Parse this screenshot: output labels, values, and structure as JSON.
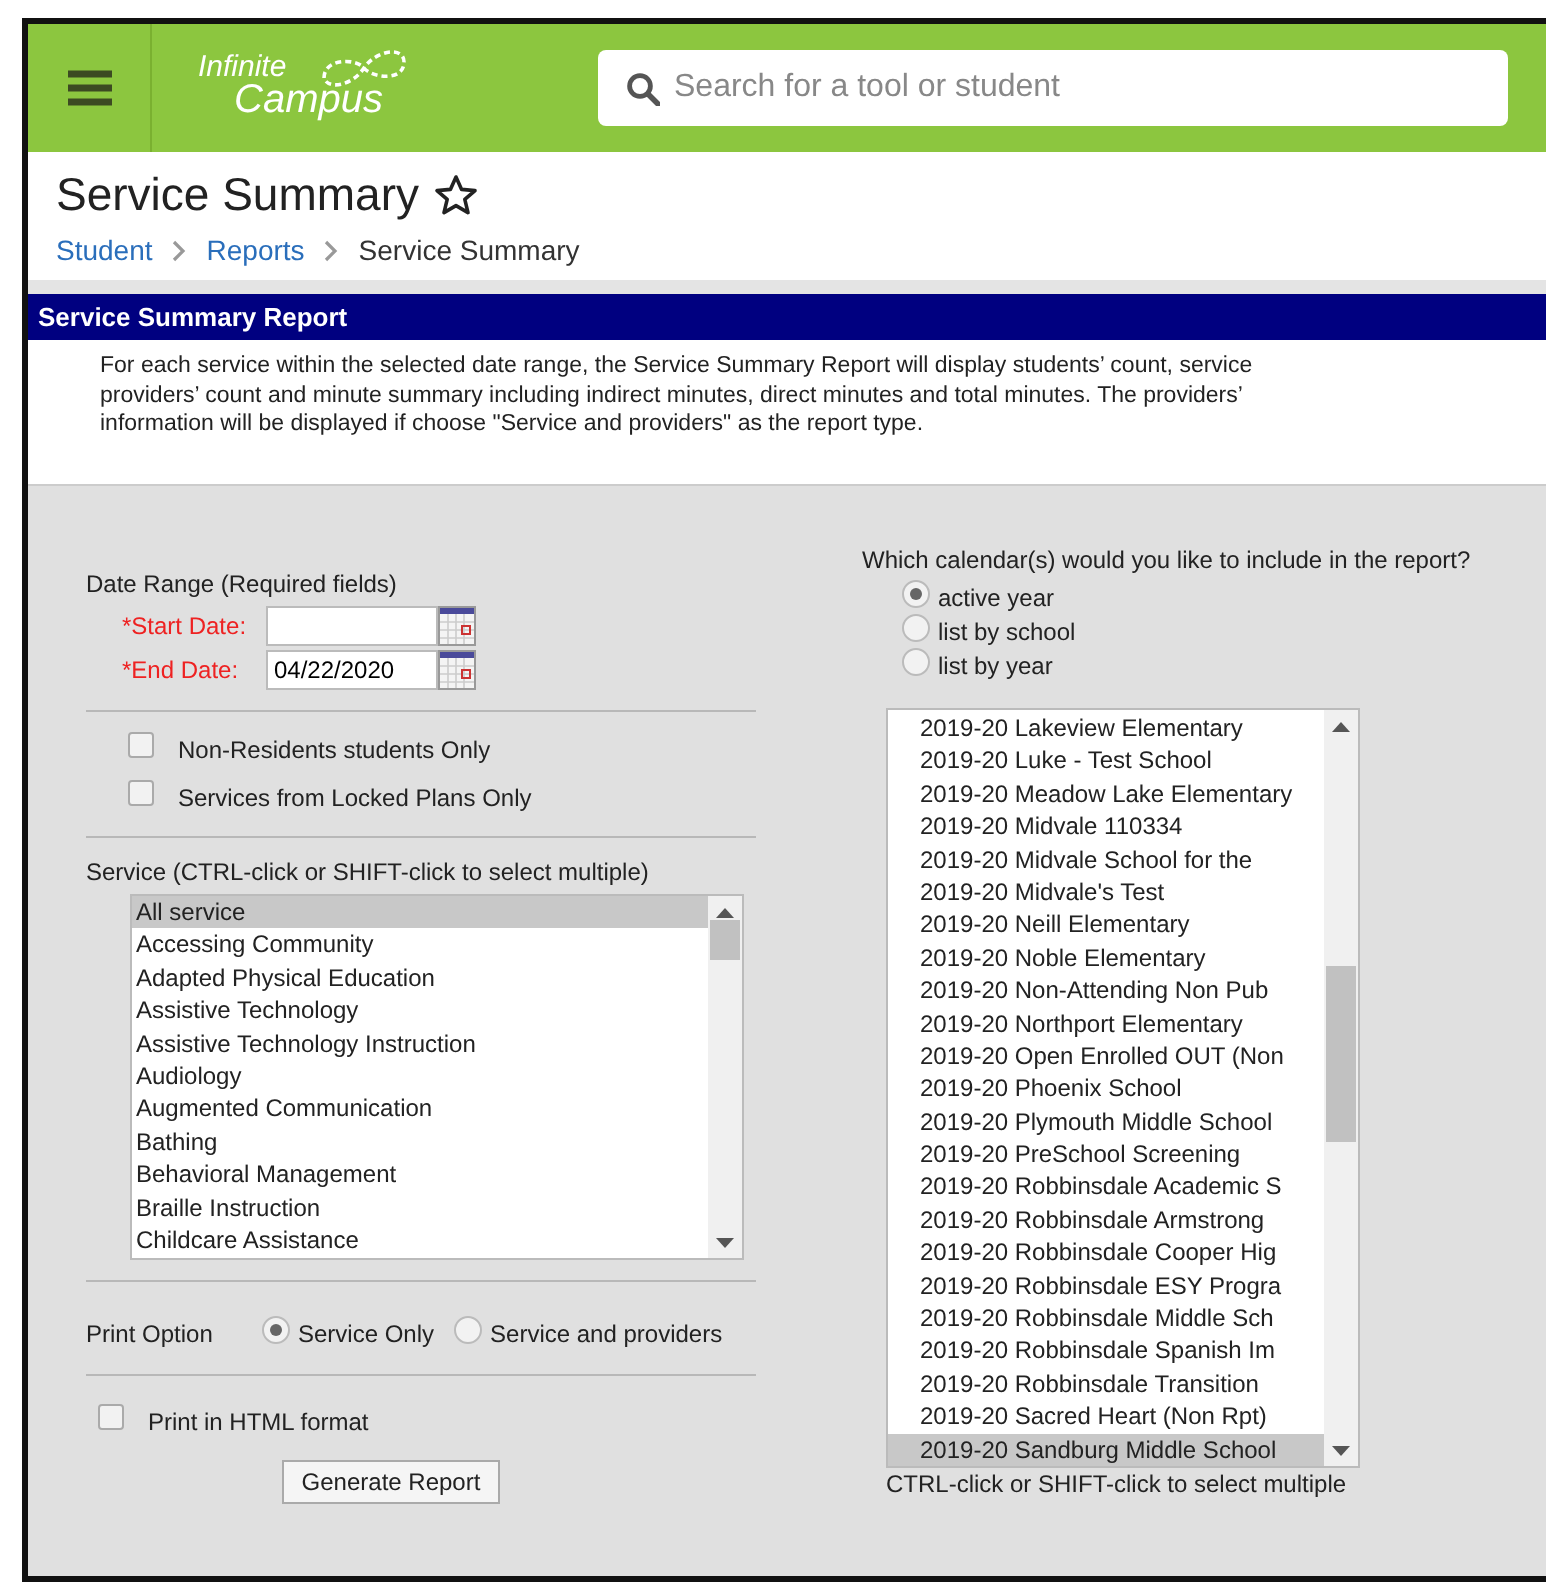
{
  "header": {
    "logo": {
      "line1": "Infinite",
      "line2": "Campus"
    },
    "search": {
      "placeholder": "Search for a tool or student"
    }
  },
  "page": {
    "title": "Service Summary",
    "breadcrumb": [
      {
        "label": "Student",
        "link": true
      },
      {
        "label": "Reports",
        "link": true
      },
      {
        "label": "Service Summary",
        "link": false
      }
    ]
  },
  "report": {
    "title": "Service Summary Report",
    "description": "For each service within the selected date range, the Service Summary Report will display students’ count, service providers’ count and minute summary including indirect minutes, direct minutes and total minutes. The providers’ information will be displayed if choose \"Service and providers\" as the report type."
  },
  "date_range": {
    "label": "Date Range (Required fields)",
    "fields": [
      {
        "label": "*Start Date:",
        "required": true
      },
      {
        "label": "*End Date:",
        "value": "04/22/2020",
        "required": true
      }
    ]
  },
  "filters": [
    {
      "label": "Non-Residents students Only",
      "checked": false
    },
    {
      "label": "Services from Locked Plans Only",
      "checked": false
    }
  ],
  "service": {
    "label": "Service (CTRL-click or SHIFT-click to select multiple)",
    "items": [
      {
        "label": "All service",
        "selected": true
      },
      {
        "label": "Accessing Community",
        "selected": false
      },
      {
        "label": "Adapted Physical Education",
        "selected": false
      },
      {
        "label": "Assistive Technology",
        "selected": false
      },
      {
        "label": "Assistive Technology Instruction",
        "selected": false
      },
      {
        "label": "Audiology",
        "selected": false
      },
      {
        "label": "Augmented Communication",
        "selected": false
      },
      {
        "label": "Bathing",
        "selected": false
      },
      {
        "label": "Behavioral Management",
        "selected": false
      },
      {
        "label": "Braille Instruction",
        "selected": false
      },
      {
        "label": "Childcare Assistance",
        "selected": false
      }
    ]
  },
  "print_option": {
    "label": "Print Option",
    "options": [
      {
        "label": "Service Only",
        "selected": true
      },
      {
        "label": "Service and providers",
        "selected": false
      }
    ]
  },
  "html_format": {
    "label": "Print in HTML format",
    "checked": false
  },
  "generate_button": "Generate Report",
  "calendars": {
    "question": "Which calendar(s) would you like to include in the report?",
    "options": [
      {
        "label": "active year",
        "selected": true
      },
      {
        "label": "list by school",
        "selected": false
      },
      {
        "label": "list by year",
        "selected": false
      }
    ],
    "items": [
      {
        "label": "2019-20 Lakeview Elementary",
        "selected": false
      },
      {
        "label": "2019-20 Luke - Test School",
        "selected": false
      },
      {
        "label": "2019-20 Meadow Lake Elementary",
        "selected": false
      },
      {
        "label": "2019-20 Midvale 110334",
        "selected": false
      },
      {
        "label": "2019-20 Midvale School for the",
        "selected": false
      },
      {
        "label": "2019-20 Midvale's Test",
        "selected": false
      },
      {
        "label": "2019-20 Neill Elementary",
        "selected": false
      },
      {
        "label": "2019-20 Noble Elementary",
        "selected": false
      },
      {
        "label": "2019-20 Non-Attending Non Pub",
        "selected": false
      },
      {
        "label": "2019-20 Northport Elementary",
        "selected": false
      },
      {
        "label": "2019-20 Open Enrolled OUT (Non",
        "selected": false
      },
      {
        "label": "2019-20 Phoenix School",
        "selected": false
      },
      {
        "label": "2019-20 Plymouth Middle School",
        "selected": false
      },
      {
        "label": "2019-20 PreSchool Screening",
        "selected": false
      },
      {
        "label": "2019-20 Robbinsdale Academic S",
        "selected": false
      },
      {
        "label": "2019-20 Robbinsdale Armstrong",
        "selected": false
      },
      {
        "label": "2019-20 Robbinsdale Cooper Hig",
        "selected": false
      },
      {
        "label": "2019-20 Robbinsdale ESY Progra",
        "selected": false
      },
      {
        "label": "2019-20 Robbinsdale Middle Sch",
        "selected": false
      },
      {
        "label": "2019-20 Robbinsdale Spanish Im",
        "selected": false
      },
      {
        "label": "2019-20 Robbinsdale Transition",
        "selected": false
      },
      {
        "label": "2019-20 Sacred Heart (Non Rpt)",
        "selected": false
      },
      {
        "label": "2019-20 Sandburg Middle School",
        "selected": true
      }
    ],
    "hint": "CTRL-click or SHIFT-click to select multiple"
  }
}
